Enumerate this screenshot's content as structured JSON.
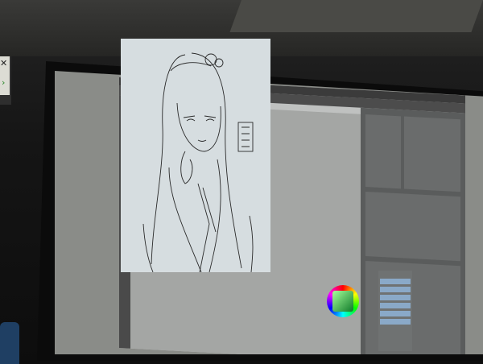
{
  "scene": {
    "description_visible_text": "",
    "colors": {
      "screen": "#8a8c88",
      "paper": "#d6dde0",
      "ui_panel": "#5a5c5c",
      "accent": "#3a86d8"
    }
  }
}
